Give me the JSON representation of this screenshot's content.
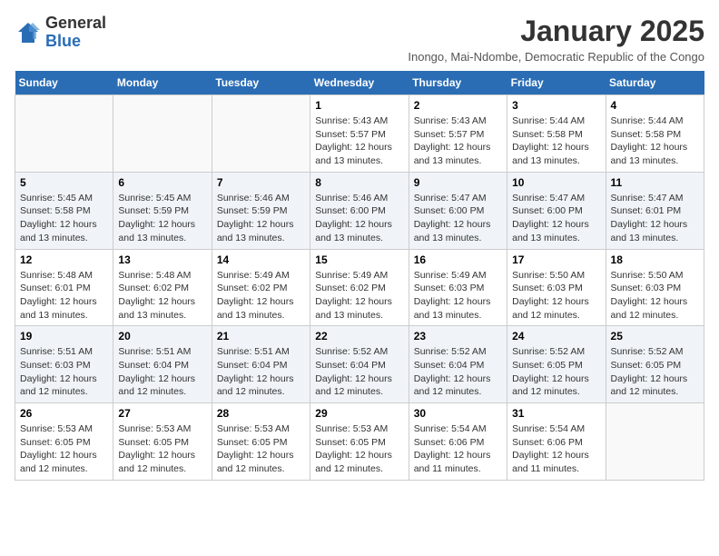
{
  "logo": {
    "general": "General",
    "blue": "Blue"
  },
  "header": {
    "title": "January 2025",
    "subtitle": "Inongo, Mai-Ndombe, Democratic Republic of the Congo"
  },
  "days_of_week": [
    "Sunday",
    "Monday",
    "Tuesday",
    "Wednesday",
    "Thursday",
    "Friday",
    "Saturday"
  ],
  "weeks": [
    [
      {
        "day": "",
        "info": ""
      },
      {
        "day": "",
        "info": ""
      },
      {
        "day": "",
        "info": ""
      },
      {
        "day": "1",
        "info": "Sunrise: 5:43 AM\nSunset: 5:57 PM\nDaylight: 12 hours and 13 minutes."
      },
      {
        "day": "2",
        "info": "Sunrise: 5:43 AM\nSunset: 5:57 PM\nDaylight: 12 hours and 13 minutes."
      },
      {
        "day": "3",
        "info": "Sunrise: 5:44 AM\nSunset: 5:58 PM\nDaylight: 12 hours and 13 minutes."
      },
      {
        "day": "4",
        "info": "Sunrise: 5:44 AM\nSunset: 5:58 PM\nDaylight: 12 hours and 13 minutes."
      }
    ],
    [
      {
        "day": "5",
        "info": "Sunrise: 5:45 AM\nSunset: 5:58 PM\nDaylight: 12 hours and 13 minutes."
      },
      {
        "day": "6",
        "info": "Sunrise: 5:45 AM\nSunset: 5:59 PM\nDaylight: 12 hours and 13 minutes."
      },
      {
        "day": "7",
        "info": "Sunrise: 5:46 AM\nSunset: 5:59 PM\nDaylight: 12 hours and 13 minutes."
      },
      {
        "day": "8",
        "info": "Sunrise: 5:46 AM\nSunset: 6:00 PM\nDaylight: 12 hours and 13 minutes."
      },
      {
        "day": "9",
        "info": "Sunrise: 5:47 AM\nSunset: 6:00 PM\nDaylight: 12 hours and 13 minutes."
      },
      {
        "day": "10",
        "info": "Sunrise: 5:47 AM\nSunset: 6:00 PM\nDaylight: 12 hours and 13 minutes."
      },
      {
        "day": "11",
        "info": "Sunrise: 5:47 AM\nSunset: 6:01 PM\nDaylight: 12 hours and 13 minutes."
      }
    ],
    [
      {
        "day": "12",
        "info": "Sunrise: 5:48 AM\nSunset: 6:01 PM\nDaylight: 12 hours and 13 minutes."
      },
      {
        "day": "13",
        "info": "Sunrise: 5:48 AM\nSunset: 6:02 PM\nDaylight: 12 hours and 13 minutes."
      },
      {
        "day": "14",
        "info": "Sunrise: 5:49 AM\nSunset: 6:02 PM\nDaylight: 12 hours and 13 minutes."
      },
      {
        "day": "15",
        "info": "Sunrise: 5:49 AM\nSunset: 6:02 PM\nDaylight: 12 hours and 13 minutes."
      },
      {
        "day": "16",
        "info": "Sunrise: 5:49 AM\nSunset: 6:03 PM\nDaylight: 12 hours and 13 minutes."
      },
      {
        "day": "17",
        "info": "Sunrise: 5:50 AM\nSunset: 6:03 PM\nDaylight: 12 hours and 12 minutes."
      },
      {
        "day": "18",
        "info": "Sunrise: 5:50 AM\nSunset: 6:03 PM\nDaylight: 12 hours and 12 minutes."
      }
    ],
    [
      {
        "day": "19",
        "info": "Sunrise: 5:51 AM\nSunset: 6:03 PM\nDaylight: 12 hours and 12 minutes."
      },
      {
        "day": "20",
        "info": "Sunrise: 5:51 AM\nSunset: 6:04 PM\nDaylight: 12 hours and 12 minutes."
      },
      {
        "day": "21",
        "info": "Sunrise: 5:51 AM\nSunset: 6:04 PM\nDaylight: 12 hours and 12 minutes."
      },
      {
        "day": "22",
        "info": "Sunrise: 5:52 AM\nSunset: 6:04 PM\nDaylight: 12 hours and 12 minutes."
      },
      {
        "day": "23",
        "info": "Sunrise: 5:52 AM\nSunset: 6:04 PM\nDaylight: 12 hours and 12 minutes."
      },
      {
        "day": "24",
        "info": "Sunrise: 5:52 AM\nSunset: 6:05 PM\nDaylight: 12 hours and 12 minutes."
      },
      {
        "day": "25",
        "info": "Sunrise: 5:52 AM\nSunset: 6:05 PM\nDaylight: 12 hours and 12 minutes."
      }
    ],
    [
      {
        "day": "26",
        "info": "Sunrise: 5:53 AM\nSunset: 6:05 PM\nDaylight: 12 hours and 12 minutes."
      },
      {
        "day": "27",
        "info": "Sunrise: 5:53 AM\nSunset: 6:05 PM\nDaylight: 12 hours and 12 minutes."
      },
      {
        "day": "28",
        "info": "Sunrise: 5:53 AM\nSunset: 6:05 PM\nDaylight: 12 hours and 12 minutes."
      },
      {
        "day": "29",
        "info": "Sunrise: 5:53 AM\nSunset: 6:05 PM\nDaylight: 12 hours and 12 minutes."
      },
      {
        "day": "30",
        "info": "Sunrise: 5:54 AM\nSunset: 6:06 PM\nDaylight: 12 hours and 11 minutes."
      },
      {
        "day": "31",
        "info": "Sunrise: 5:54 AM\nSunset: 6:06 PM\nDaylight: 12 hours and 11 minutes."
      },
      {
        "day": "",
        "info": ""
      }
    ]
  ]
}
